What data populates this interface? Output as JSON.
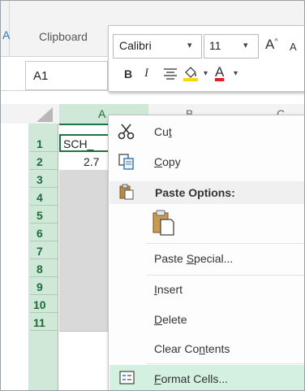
{
  "ribbon": {
    "left_letter": "A",
    "clipboard_label": "Clipboard"
  },
  "name_box": {
    "value": "A1"
  },
  "mini_toolbar": {
    "font_name": "Calibri",
    "font_size": "11",
    "grow_font": "A",
    "shrink_font": "A",
    "bold": "B",
    "italic": "I",
    "font_color": "A",
    "accent_font_color": "#e02020",
    "accent_fill_color": "#f5d90a"
  },
  "grid": {
    "columns": [
      "A",
      "B",
      "C"
    ],
    "rows": [
      "1",
      "2",
      "3",
      "4",
      "5",
      "6",
      "7",
      "8",
      "9",
      "10",
      "11"
    ],
    "cells": {
      "A1": "SCH_",
      "A2": "2.7"
    },
    "header_accent": "#217346"
  },
  "context_menu": {
    "cut": {
      "pre": "Cu",
      "key": "t",
      "post": ""
    },
    "copy": {
      "pre": "",
      "key": "C",
      "post": "opy"
    },
    "paste_options": "Paste Options:",
    "paste_special": {
      "pre": "Paste ",
      "key": "S",
      "post": "pecial..."
    },
    "insert": {
      "pre": "",
      "key": "I",
      "post": "nsert"
    },
    "delete": {
      "pre": "",
      "key": "D",
      "post": "elete"
    },
    "clear_contents": {
      "pre": "Clear Co",
      "key": "n",
      "post": "tents"
    },
    "format_cells": {
      "pre": "",
      "key": "F",
      "post": "ormat Cells..."
    },
    "hover_color": "#d3f0e0"
  },
  "icons": {
    "cut": "scissors-icon",
    "copy": "copy-icon",
    "paste_header": "paste-icon",
    "paste_option": "clipboard-paste-icon",
    "format_cells": "format-cells-icon"
  }
}
